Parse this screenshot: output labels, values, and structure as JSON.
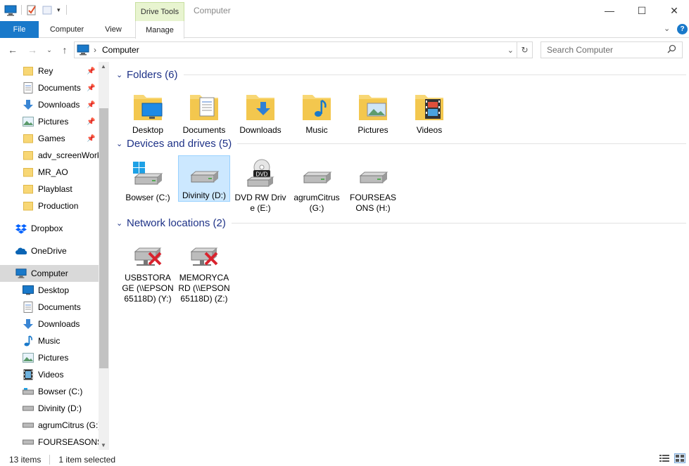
{
  "window": {
    "title": "Computer",
    "ribbon_context": "Drive Tools",
    "controls": [
      "—",
      "☐",
      "✕"
    ]
  },
  "ribbon": {
    "tabs": [
      "File",
      "Computer",
      "View",
      "Manage"
    ]
  },
  "address": {
    "path": "Computer",
    "search_placeholder": "Search Computer"
  },
  "nav": {
    "quick_access": [
      {
        "label": "Rey",
        "icon": "folder-icon",
        "pinned": true
      },
      {
        "label": "Documents",
        "icon": "documents-icon",
        "pinned": true
      },
      {
        "label": "Downloads",
        "icon": "downloads-icon",
        "pinned": true
      },
      {
        "label": "Pictures",
        "icon": "pictures-icon",
        "pinned": true
      },
      {
        "label": "Games",
        "icon": "folder-icon",
        "pinned": true
      },
      {
        "label": "adv_screenWork",
        "icon": "folder-icon",
        "pinned": false
      },
      {
        "label": "MR_AO",
        "icon": "folder-icon",
        "pinned": false
      },
      {
        "label": "Playblast",
        "icon": "folder-icon",
        "pinned": false
      },
      {
        "label": "Production",
        "icon": "folder-icon",
        "pinned": false
      }
    ],
    "dropbox": "Dropbox",
    "onedrive": "OneDrive",
    "computer": "Computer",
    "computer_children": [
      {
        "label": "Desktop",
        "icon": "desktop-icon"
      },
      {
        "label": "Documents",
        "icon": "documents-icon"
      },
      {
        "label": "Downloads",
        "icon": "downloads-icon"
      },
      {
        "label": "Music",
        "icon": "music-icon"
      },
      {
        "label": "Pictures",
        "icon": "pictures-icon"
      },
      {
        "label": "Videos",
        "icon": "videos-icon"
      },
      {
        "label": "Bowser (C:)",
        "icon": "drive-icon"
      },
      {
        "label": "Divinity (D:)",
        "icon": "drive-icon"
      },
      {
        "label": "agrumCitrus (G:)",
        "icon": "drive-icon"
      },
      {
        "label": "FOURSEASONS (",
        "icon": "drive-icon"
      }
    ]
  },
  "groups": {
    "folders": {
      "title": "Folders (6)",
      "items": [
        {
          "label": "Desktop",
          "icon": "desktop-folder-icon"
        },
        {
          "label": "Documents",
          "icon": "documents-folder-icon"
        },
        {
          "label": "Downloads",
          "icon": "downloads-folder-icon"
        },
        {
          "label": "Music",
          "icon": "music-folder-icon"
        },
        {
          "label": "Pictures",
          "icon": "pictures-folder-icon"
        },
        {
          "label": "Videos",
          "icon": "videos-folder-icon"
        }
      ]
    },
    "devices": {
      "title": "Devices and drives (5)",
      "items": [
        {
          "label": "Bowser (C:)",
          "icon": "windows-drive-icon"
        },
        {
          "label": "Divinity (D:)",
          "icon": "drive-icon",
          "selected": true
        },
        {
          "label": "DVD RW Drive (E:)",
          "icon": "dvd-drive-icon",
          "badge": "DVD"
        },
        {
          "label": "agrumCitrus (G:)",
          "icon": "drive-icon"
        },
        {
          "label": "FOURSEASONS (H:)",
          "icon": "drive-icon"
        }
      ]
    },
    "network": {
      "title": "Network locations (2)",
      "items": [
        {
          "label": "USBSTORAGE (\\\\EPSON65118D) (Y:)",
          "icon": "disconnected-network-drive-icon"
        },
        {
          "label": "MEMORYCARD (\\\\EPSON65118D) (Z:)",
          "icon": "disconnected-network-drive-icon"
        }
      ]
    }
  },
  "status": {
    "count": "13 items",
    "selected": "1 item selected"
  },
  "colors": {
    "accent": "#1979ca",
    "group_title": "#1e3287",
    "selection": "#cce8ff",
    "folder": "#f8d775"
  }
}
